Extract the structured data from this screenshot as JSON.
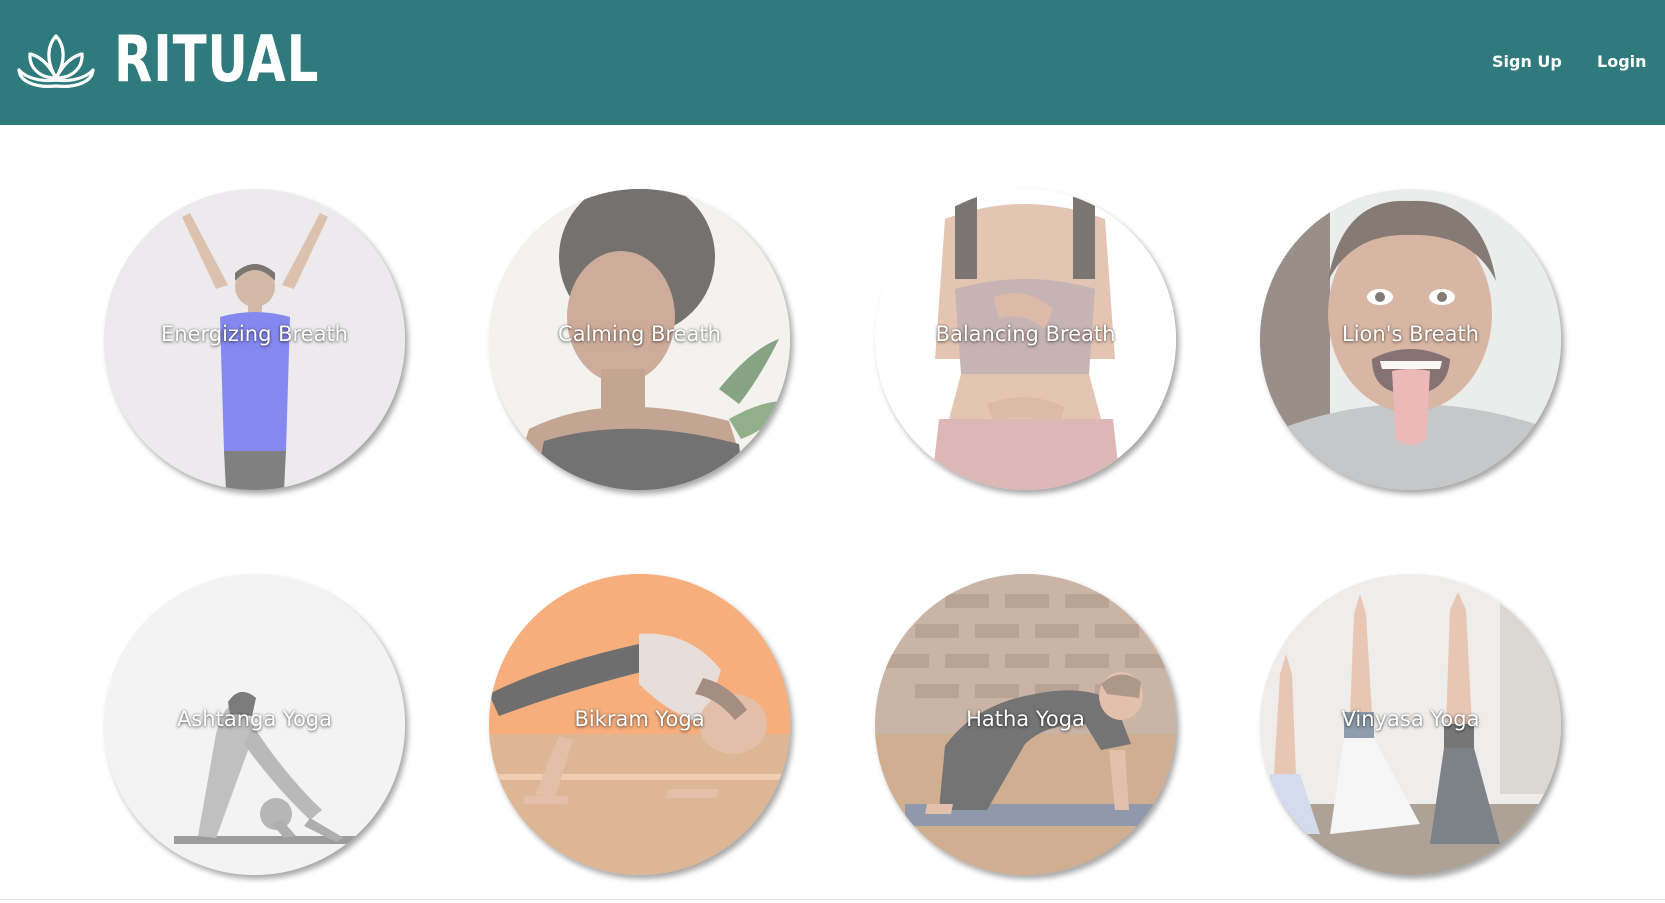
{
  "header": {
    "brand_name": "RITUAL",
    "logo_icon": "lotus-icon",
    "background_color": "#2e7a7c",
    "nav": {
      "signup_label": "Sign Up",
      "login_label": "Login"
    }
  },
  "practices": [
    {
      "label": "Energizing Breath",
      "photo": "woman-arms-raised"
    },
    {
      "label": "Calming Breath",
      "photo": "woman-eyes-closed"
    },
    {
      "label": "Balancing Breath",
      "photo": "hands-on-chest-and-belly"
    },
    {
      "label": "Lion's Breath",
      "photo": "man-tongue-out"
    },
    {
      "label": "Ashtanga Yoga",
      "photo": "man-downward-pose"
    },
    {
      "label": "Bikram Yoga",
      "photo": "woman-arm-balance"
    },
    {
      "label": "Hatha Yoga",
      "photo": "woman-cat-pose"
    },
    {
      "label": "Vinyasa Yoga",
      "photo": "group-arms-raised"
    }
  ]
}
